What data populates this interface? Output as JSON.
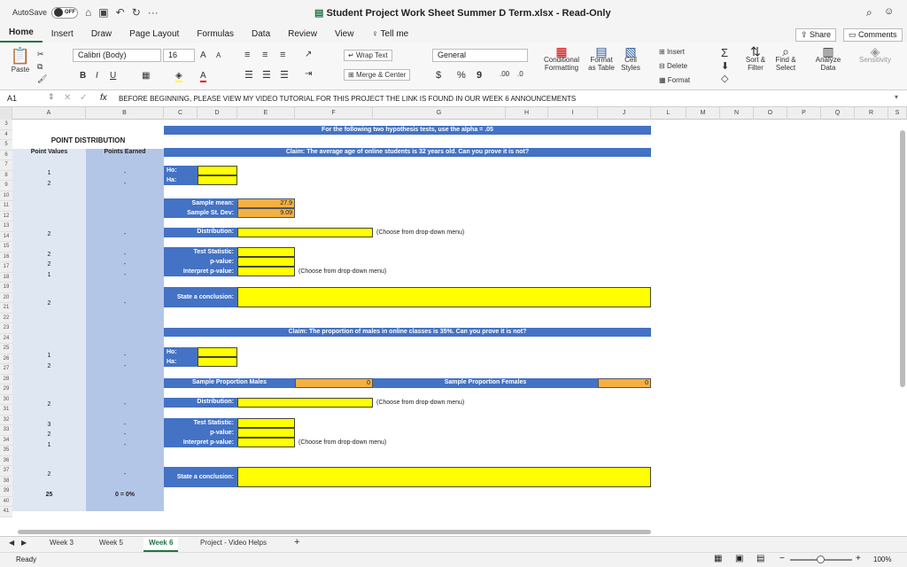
{
  "titlebar": {
    "autosave_label": "AutoSave",
    "autosave_state": "OFF",
    "more": "···",
    "title": "Student Project Work Sheet Summer D Term.xlsx  -  Read-Only"
  },
  "ribbon_tabs": [
    "Home",
    "Insert",
    "Draw",
    "Page Layout",
    "Formulas",
    "Data",
    "Review",
    "View",
    "Tell me"
  ],
  "share": "Share",
  "comments": "Comments",
  "ribbon": {
    "paste": "Paste",
    "font_name": "Calibri (Body)",
    "font_size": "16",
    "bold": "B",
    "italic": "I",
    "underline": "U",
    "wrap": "Wrap Text",
    "merge": "Merge & Center",
    "number_format": "General",
    "currency": "$",
    "percent": "%",
    "comma": "9",
    "conditional": "Conditional Formatting",
    "format_table": "Format as Table",
    "cell_styles": "Cell Styles",
    "insert": "Insert",
    "delete": "Delete",
    "format": "Format",
    "sort": "Sort & Filter",
    "find": "Find & Select",
    "analyze": "Analyze Data",
    "sensitivity": "Sensitivity",
    "grow": "A",
    "shrink": "A"
  },
  "formula": {
    "namebox": "A1",
    "fx": "fx",
    "content": "BEFORE BEGINNING, PLEASE VIEW MY VIDEO TUTORIAL FOR THIS PROJECT   THE LINK IS FOUND IN OUR WEEK 6 ANNOUNCEMENTS"
  },
  "columns": [
    "A",
    "B",
    "C",
    "D",
    "E",
    "F",
    "G",
    "H",
    "I",
    "J",
    "L",
    "M",
    "N",
    "O",
    "P",
    "Q",
    "R",
    "S"
  ],
  "rows": [
    "3",
    "4",
    "5",
    "6",
    "7",
    "8",
    "9",
    "10",
    "11",
    "12",
    "13",
    "14",
    "15",
    "16",
    "17",
    "18",
    "19",
    "20",
    "21",
    "22",
    "23",
    "24",
    "25",
    "26",
    "27",
    "28",
    "29",
    "30",
    "31",
    "32",
    "33",
    "34",
    "35",
    "36",
    "37",
    "38",
    "39",
    "40",
    "41"
  ],
  "sheet": {
    "pd_title": "POINT DISTRIBUTION",
    "pv": "Point Values",
    "pe": "Points Earned",
    "band1": "For the following two hypothesis tests, use the alpha = .05",
    "claim1": "Claim: The average age of online students is 32 years old. Can you prove it is not?",
    "claim2": "Claim: The proportion of males in online classes is 35%. Can you prove it is not?",
    "h0": "Ho:",
    "ha": "Ha:",
    "sample_mean": "Sample mean:",
    "sample_sd": "Sample St. Dev:",
    "mean_val": "27.9",
    "sd_val": "9.09",
    "distribution": "Distribution:",
    "choose": "(Choose from drop-down menu)",
    "test_stat": "Test Statistic:",
    "pvalue": "p-value:",
    "interpret": "Interpret p-value:",
    "conclusion": "State a conclusion:",
    "prop_males": "Sample Proportion Males",
    "prop_females": "Sample Proportion Females",
    "zero": "0",
    "points": [
      "1",
      "2",
      "2",
      "2",
      "2",
      "1",
      "2",
      "1",
      "2",
      "2",
      "3",
      "2",
      "1",
      "2"
    ],
    "dash": "-",
    "total": "25",
    "earned_total": "0 = 0%"
  },
  "sheet_tabs": [
    "Week 3",
    "Week 5",
    "Week 6",
    "Project - Video Helps"
  ],
  "status": {
    "ready": "Ready",
    "zoom": "100%"
  }
}
